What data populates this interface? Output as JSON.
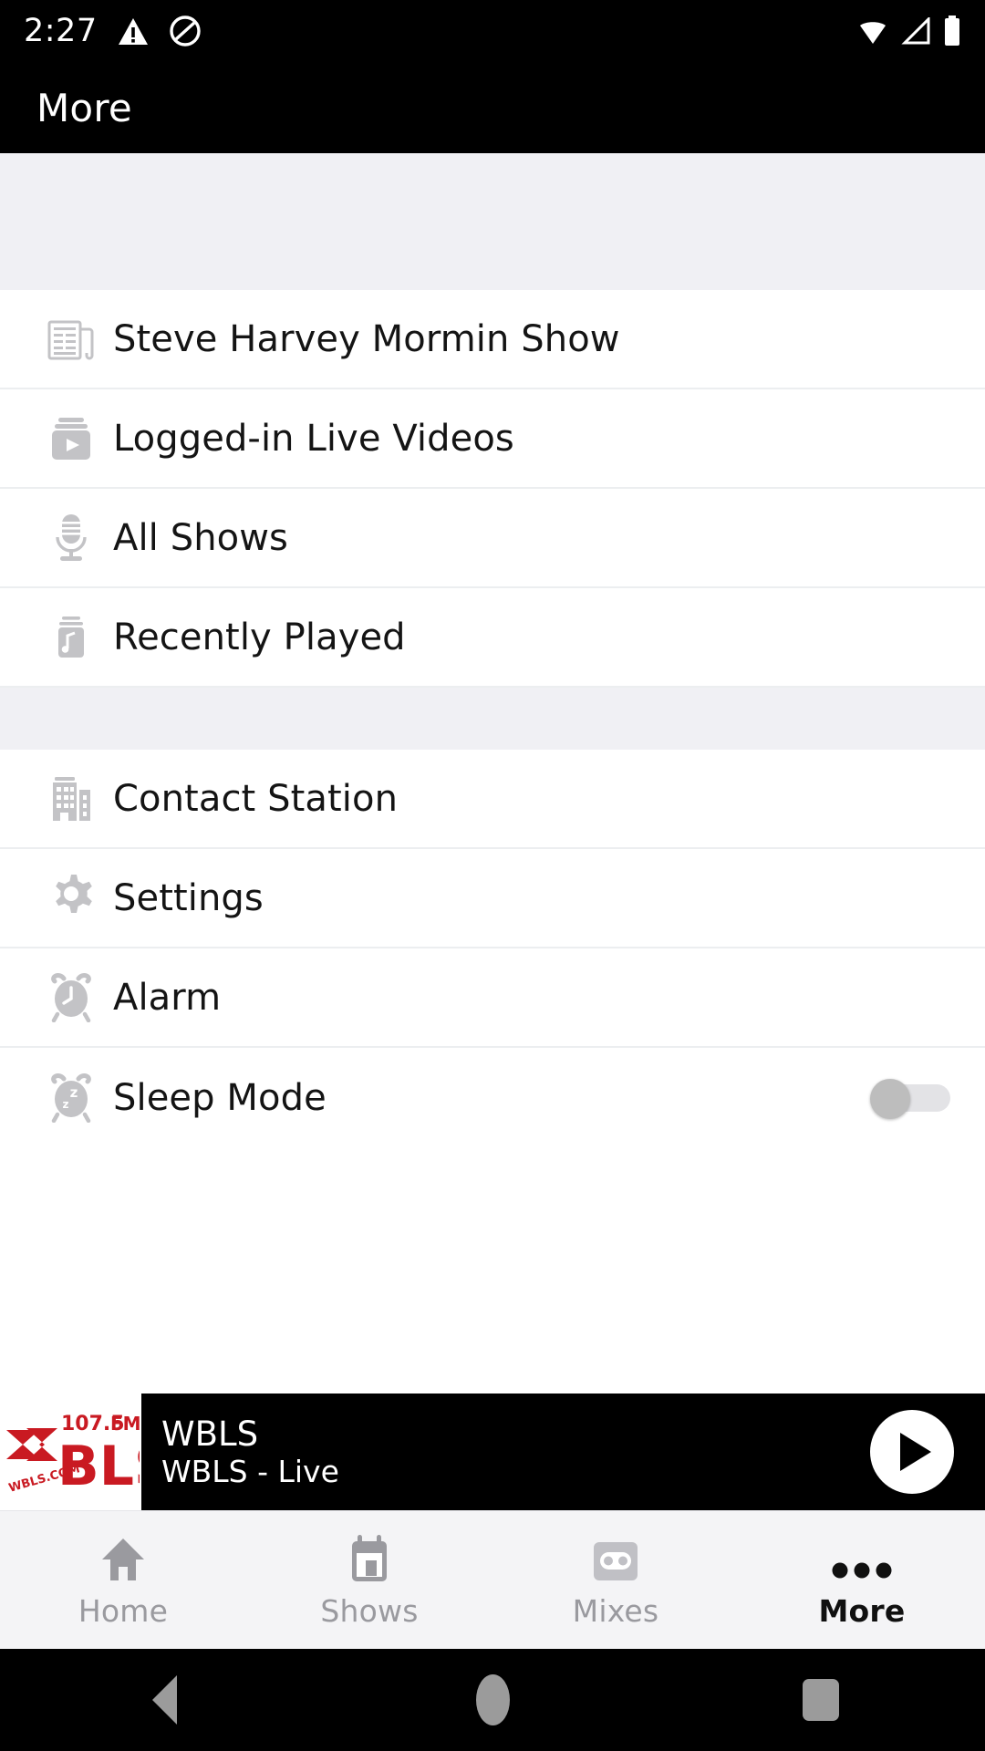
{
  "status_bar": {
    "time": "2:27",
    "left_icons": [
      "warning-triangle-icon",
      "do-not-disturb-icon"
    ],
    "right_icons": [
      "wifi-icon",
      "cellular-signal-icon",
      "battery-icon"
    ]
  },
  "header": {
    "title": "More"
  },
  "menu": {
    "section_one": [
      {
        "label": "Steve Harvey Mormin Show",
        "icon": "newspaper-icon"
      },
      {
        "label": "Logged-in Live Videos",
        "icon": "video-box-icon"
      },
      {
        "label": "All Shows",
        "icon": "microphone-icon"
      },
      {
        "label": "Recently Played",
        "icon": "music-note-box-icon"
      }
    ],
    "section_two": [
      {
        "label": "Contact Station",
        "icon": "building-icon",
        "toggle": null
      },
      {
        "label": "Settings",
        "icon": "gear-icon",
        "toggle": null
      },
      {
        "label": "Alarm",
        "icon": "alarm-clock-icon",
        "toggle": null
      },
      {
        "label": "Sleep Mode",
        "icon": "sleep-clock-icon",
        "toggle": "off"
      }
    ]
  },
  "player": {
    "station_title": "WBLS",
    "now_playing": "WBLS - Live",
    "logo_text_top": "107.5",
    "logo_text_fm": "FM",
    "logo_text_main": "BLS",
    "logo_text_url": "WBLS.COM",
    "logo_color": "#C91A22",
    "play_button": "play-icon",
    "bar_background": "#000000"
  },
  "bottom_nav": {
    "items": [
      {
        "label": "Home",
        "icon": "home-icon",
        "active": false
      },
      {
        "label": "Shows",
        "icon": "calendar-icon",
        "active": false
      },
      {
        "label": "Mixes",
        "icon": "cassette-icon",
        "active": false
      },
      {
        "label": "More",
        "icon": "ellipsis-icon",
        "active": true
      }
    ],
    "active_color": "#101010",
    "inactive_color": "#9A9A9F"
  },
  "android_nav": {
    "back": "back-triangle-icon",
    "home": "home-circle-icon",
    "recents": "recents-square-icon"
  },
  "theme": {
    "section_divider_bg": "#F0F0F4",
    "row_bg": "#FFFFFF",
    "icon_gray": "#BDBDBD",
    "text_primary": "#141414"
  }
}
